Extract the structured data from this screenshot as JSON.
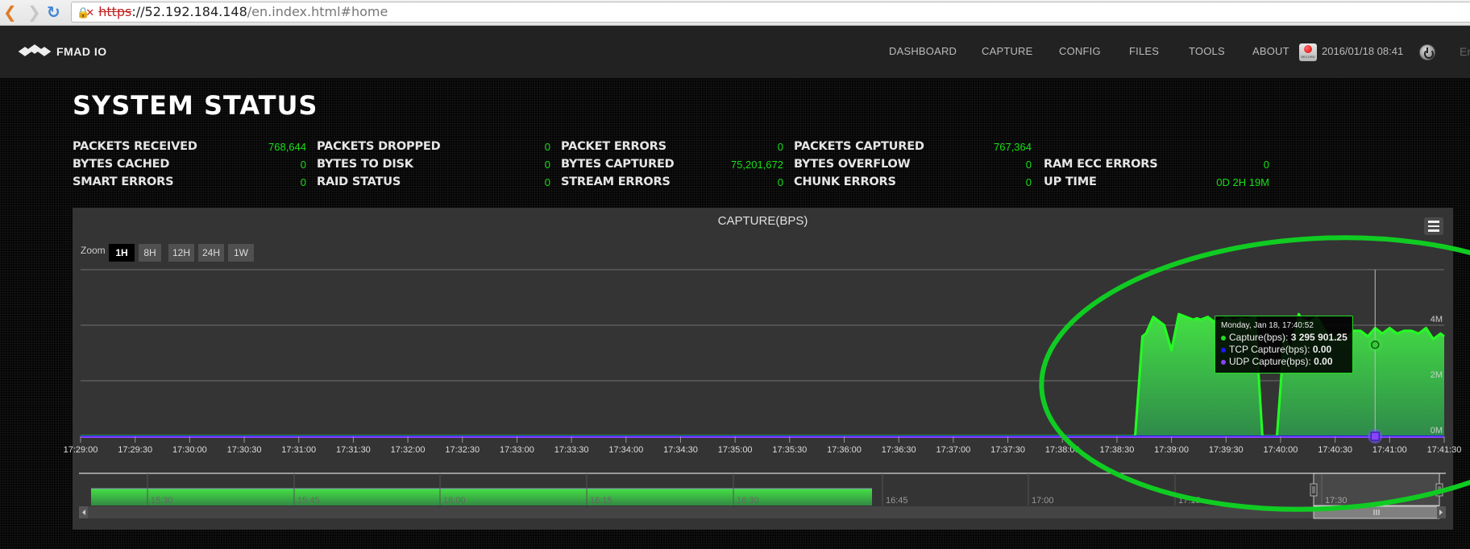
{
  "browser": {
    "url_protocol": "https",
    "url_host": "52.192.184.148",
    "url_path": "/en.index.html#home"
  },
  "nav": {
    "logo_text": "FMAD IO",
    "items": [
      "DASHBOARD",
      "CAPTURE",
      "CONFIG",
      "FILES",
      "TOOLS",
      "ABOUT"
    ],
    "record_label": "RECORD",
    "datetime": "2016/01/18 08:41",
    "language": "En"
  },
  "page_title": "SYSTEM STATUS",
  "stats": [
    {
      "label": "PACKETS RECEIVED",
      "value": "768,644"
    },
    {
      "label": "PACKETS DROPPED",
      "value": "0"
    },
    {
      "label": "PACKET ERRORS",
      "value": "0"
    },
    {
      "label": "PACKETS CAPTURED",
      "value": "767,364"
    },
    {
      "label": "BYTES CACHED",
      "value": "0"
    },
    {
      "label": "BYTES TO DISK",
      "value": "0"
    },
    {
      "label": "BYTES CAPTURED",
      "value": "75,201,672"
    },
    {
      "label": "BYTES OVERFLOW",
      "value": "0"
    },
    {
      "label": "RAM ECC ERRORS",
      "value": "0"
    },
    {
      "label": "SMART ERRORS",
      "value": "0"
    },
    {
      "label": "RAID STATUS",
      "value": "0"
    },
    {
      "label": "STREAM ERRORS",
      "value": "0"
    },
    {
      "label": "CHUNK ERRORS",
      "value": "0"
    },
    {
      "label": "UP TIME",
      "value": "0D 2H 19M"
    }
  ],
  "chart": {
    "zoom_label": "Zoom",
    "zoom_buttons": [
      "1H",
      "8H",
      "12H",
      "24H",
      "1W"
    ],
    "zoom_active": "1H",
    "tooltip": {
      "date": "Monday, Jan 18, 17:40:52",
      "rows": [
        {
          "name": "Capture(bps)",
          "value": "3 295 901.25",
          "color": "#22dd22"
        },
        {
          "name": "TCP Capture(bps)",
          "value": "0.00",
          "color": "#1a1aff"
        },
        {
          "name": "UDP Capture(bps)",
          "value": "0.00",
          "color": "#8844ff"
        }
      ]
    },
    "navigator": {
      "labels": [
        "15:30",
        "15:45",
        "16:00",
        "16:15",
        "16:30",
        "16:45",
        "17:00",
        "17:15",
        "17:30"
      ]
    }
  },
  "chart_data": {
    "type": "area",
    "title": "CAPTURE(BPS)",
    "xlabel": "",
    "ylabel": "",
    "x_tick_labels": [
      "17:29:00",
      "17:29:30",
      "17:30:00",
      "17:30:30",
      "17:31:00",
      "17:31:30",
      "17:32:00",
      "17:32:30",
      "17:33:00",
      "17:33:30",
      "17:34:00",
      "17:34:30",
      "17:35:00",
      "17:35:30",
      "17:36:00",
      "17:36:30",
      "17:37:00",
      "17:37:30",
      "17:38:00",
      "17:38:30",
      "17:39:00",
      "17:39:30",
      "17:40:00",
      "17:40:30",
      "17:41:00",
      "17:41:30"
    ],
    "y_tick_labels": [
      "0M",
      "2M",
      "4M"
    ],
    "ylim": [
      0,
      6000000
    ],
    "x_range_seconds": [
      0,
      750
    ],
    "grid": true,
    "colors": {
      "capture": "#22ff22",
      "tcp": "#1a1aff",
      "udp": "#8844ff"
    },
    "series": [
      {
        "name": "Capture(bps)",
        "x_seconds": [
          0,
          580,
          584,
          586,
          590,
          596,
          600,
          604,
          608,
          612,
          614,
          616,
          620,
          624,
          628,
          630,
          634,
          638,
          642,
          646,
          650,
          654,
          658,
          662,
          666,
          670,
          672,
          676,
          680,
          686,
          688,
          692,
          694,
          696,
          700,
          704,
          708,
          712,
          716,
          720,
          724,
          728,
          732,
          736,
          740,
          744,
          748,
          750
        ],
        "values": [
          0,
          0,
          3600000,
          3700000,
          4300000,
          4000000,
          3100000,
          4400000,
          4300000,
          4200000,
          4250000,
          4200000,
          4300000,
          4100000,
          4200000,
          4300000,
          4150000,
          4250000,
          4200000,
          4300000,
          0,
          0,
          0,
          3600000,
          3000000,
          4400000,
          4200000,
          4100000,
          4300000,
          3600000,
          3400000,
          3700000,
          3300000,
          3500000,
          3800000,
          3800000,
          3600000,
          3900000,
          3700000,
          3900000,
          3700000,
          3800000,
          3800000,
          3700000,
          3900000,
          3500000,
          3700000,
          3600000
        ]
      },
      {
        "name": "TCP Capture(bps)",
        "x_seconds": [
          0,
          750
        ],
        "values": [
          0,
          0
        ]
      },
      {
        "name": "UDP Capture(bps)",
        "x_seconds": [
          0,
          750
        ],
        "values": [
          0,
          0
        ]
      }
    ],
    "hover_point": {
      "x_label": "17:40:52",
      "value": 3295901.25
    }
  }
}
